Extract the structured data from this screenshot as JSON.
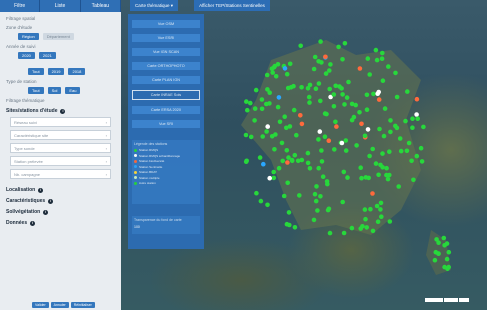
{
  "topbar": [
    "Filtre",
    "Liste",
    "Tableau"
  ],
  "map_toolbar": {
    "dropdown": "Carte thématique",
    "reset": "Afficher TEP/Stations Sentinelles"
  },
  "sidebar": {
    "section1": "Filtrage spatial",
    "group1_label": "Zone d'étude",
    "group1_buttons": [
      "Région",
      "Département"
    ],
    "group2_label": "Année de suivi",
    "group2_buttons": [
      "2020",
      "2021"
    ],
    "group3_buttons": [
      "Tout",
      "2019",
      "2018"
    ],
    "group4_label": "Type de station",
    "group4_buttons": [
      "Tout",
      "Sol",
      "Eau"
    ],
    "section2": "Filtrage thématique",
    "main_header": "Sites/stations d'étude",
    "selects": [
      "Réseau suivi",
      "Caractéristique site",
      "Type sonde",
      "Station prélevée",
      "Nb. campagne"
    ],
    "headers": [
      "Localisation",
      "Caractéristiques",
      "Sol/végétation",
      "Données"
    ],
    "bottom_buttons": [
      "Valider",
      "Annuler",
      "Réinitialiser"
    ]
  },
  "layers": {
    "buttons": [
      "Vue OSM",
      "Vue ESRI",
      "Vue IGN SCAN",
      "Carte ORTHOPHOTO",
      "Carte PLAN IGN",
      "Carte INRAE Sols",
      "Carte ERSA 2020",
      "Vue SRI"
    ],
    "selected": 5,
    "legend_title": "Légende des stations",
    "legend": [
      {
        "label": "Station RMQS",
        "color": "#27d83b"
      },
      {
        "label": "Station RMQS échantillonnage",
        "color": "#ffffff"
      },
      {
        "label": "Station biodiversité",
        "color": "#ff6a3c"
      },
      {
        "label": "Station Sentinelle",
        "color": "#2aa7ff"
      },
      {
        "label": "Station BDAT",
        "color": "#ffd83a"
      },
      {
        "label": "Station multiple",
        "color": "#c8f0c8"
      },
      {
        "label": "Autre station",
        "color": "#27d83b"
      }
    ],
    "opacity_label": "Transparence du fond de carte",
    "opacity_value": "100"
  },
  "scale": [
    "200 km",
    "100",
    "0"
  ],
  "colors": {
    "accent": "#2f6fb5",
    "marker": "#27d83b"
  }
}
